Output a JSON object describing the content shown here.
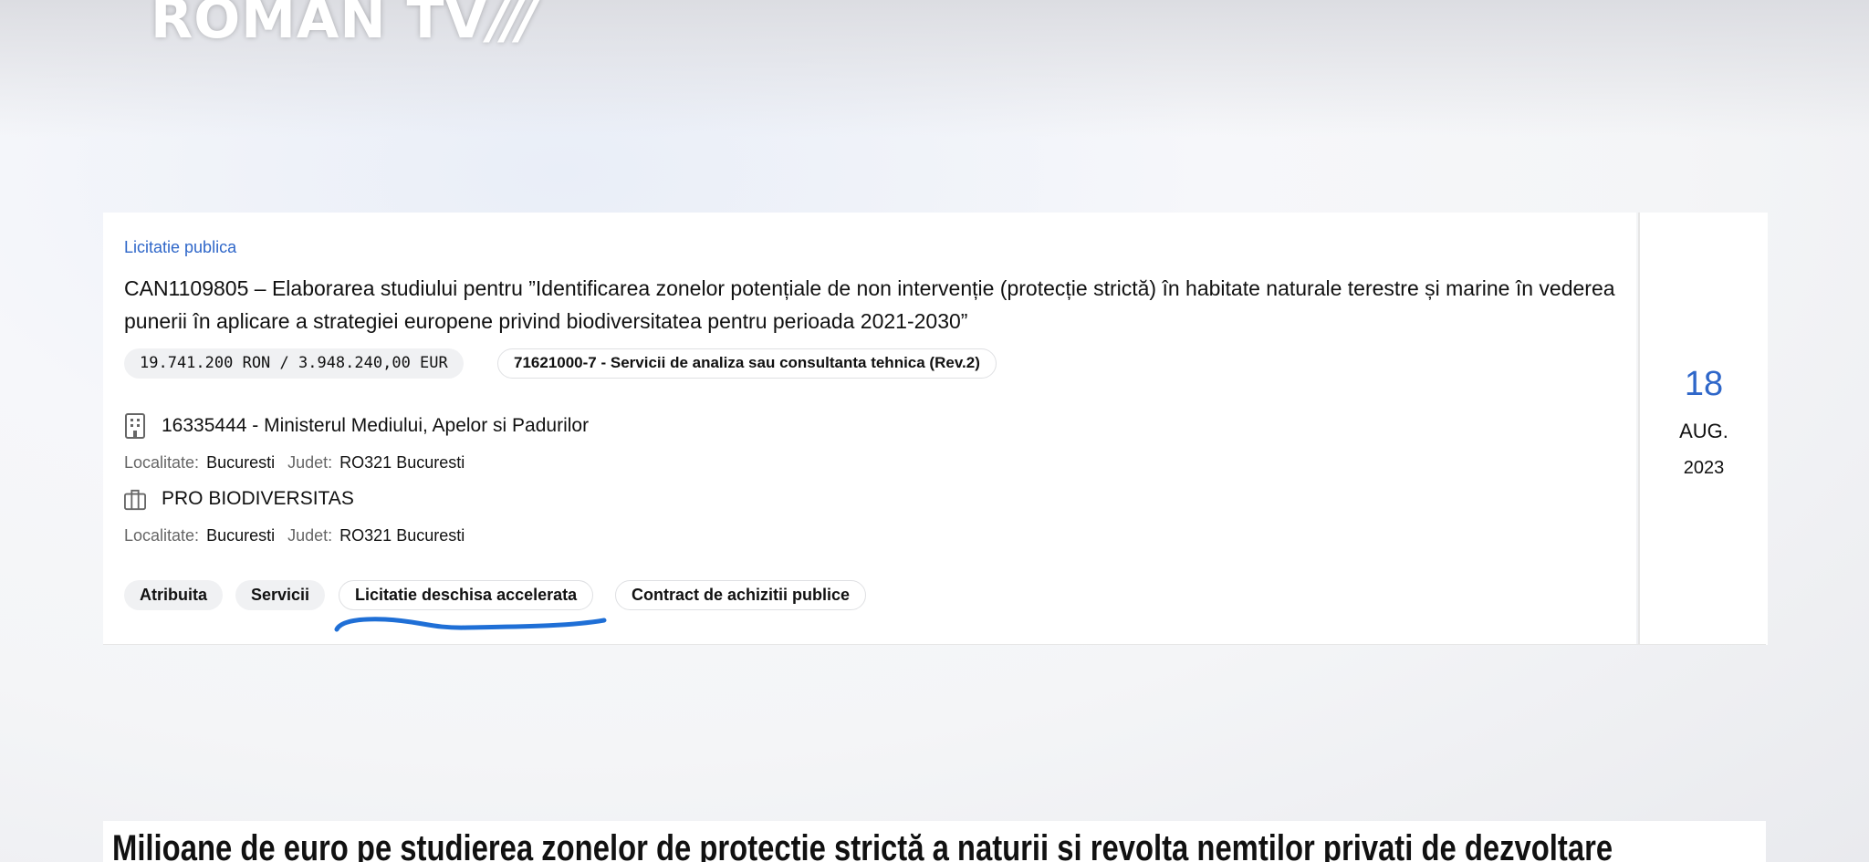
{
  "channel_logo": {
    "text": "ROMAN TV",
    "slashes": "///"
  },
  "listing": {
    "procedure_type": "Licitatie publica",
    "title": "CAN1109805 – Elaborarea studiului pentru ”Identificarea zonelor potențiale de non intervenție (protecție strictă) în habitate naturale terestre și marine în vederea punerii în aplicare a strategiei europene privind biodiversitatea pentru perioada 2021-2030”",
    "value": "19.741.200 RON / 3.948.240,00 EUR",
    "cpv": "71621000-7 - Servicii de analiza sau consultanta tehnica (Rev.2)",
    "authority": {
      "name": "16335444 - Ministerul Mediului, Apelor si Padurilor",
      "locality_label": "Localitate:",
      "locality": "Bucuresti",
      "county_label": "Judet:",
      "county": "RO321 Bucuresti",
      "icon": "building-icon"
    },
    "winner": {
      "name": "PRO BIODIVERSITAS",
      "locality_label": "Localitate:",
      "locality": "Bucuresti",
      "county_label": "Judet:",
      "county": "RO321 Bucuresti",
      "icon": "briefcase-icon"
    },
    "tags": [
      "Atribuita",
      "Servicii",
      "Licitatie deschisa accelerata",
      "Contract de achizitii publice"
    ],
    "date": {
      "day": "18",
      "month": "AUG.",
      "year": "2023"
    }
  },
  "headline": "Milioane de euro pe studierea zonelor de protecție strictă a naturii și revolta nemților privați de dezvoltare",
  "colors": {
    "accent": "#2f67c9",
    "annotation": "#1f6fd6"
  }
}
